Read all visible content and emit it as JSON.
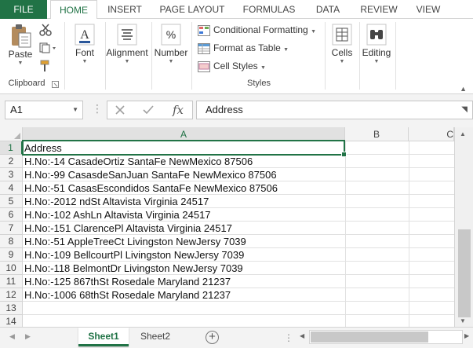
{
  "ribbon_tabs": [
    {
      "label": "FILE"
    },
    {
      "label": "HOME"
    },
    {
      "label": "INSERT"
    },
    {
      "label": "PAGE LAYOUT"
    },
    {
      "label": "FORMULAS"
    },
    {
      "label": "DATA"
    },
    {
      "label": "REVIEW"
    },
    {
      "label": "VIEW"
    }
  ],
  "clipboard": {
    "paste": "Paste",
    "group": "Clipboard"
  },
  "font": {
    "label": "Font"
  },
  "alignment": {
    "label": "Alignment"
  },
  "number": {
    "label": "Number"
  },
  "styles": {
    "conditional": "Conditional Formatting",
    "format_table": "Format as Table",
    "cell_styles": "Cell Styles",
    "group": "Styles"
  },
  "cells": {
    "label": "Cells"
  },
  "editing": {
    "label": "Editing"
  },
  "formula_bar": {
    "name_box": "A1",
    "fx": "fx",
    "content": "Address"
  },
  "grid": {
    "columns": [
      "A",
      "B",
      "C"
    ],
    "rows": [
      "1",
      "2",
      "3",
      "4",
      "5",
      "6",
      "7",
      "8",
      "9",
      "10",
      "11",
      "12",
      "13",
      "14"
    ],
    "cells_a": [
      "Address",
      "H.No:-14 CasadeOrtiz SantaFe NewMexico 87506",
      "H.No:-99 CasasdeSanJuan SantaFe NewMexico 87506",
      "H.No:-51 CasasEscondidos SantaFe NewMexico 87506",
      "H.No:-2012 ndSt Altavista Virginia 24517",
      "H.No:-102 AshLn Altavista Virginia 24517",
      "H.No:-151 ClarencePl Altavista Virginia 24517",
      "H.No:-51 AppleTreeCt Livingston NewJersy 7039",
      "H.No:-109 BellcourtPl Livingston NewJersy 7039",
      "H.No:-118 BelmontDr Livingston NewJersy 7039",
      "H.No:-125 867thSt Rosedale Maryland 21237",
      "H.No:-1006 68thSt Rosedale Maryland 21237"
    ]
  },
  "sheets": [
    {
      "label": "Sheet1"
    },
    {
      "label": "Sheet2"
    }
  ],
  "add_sheet": "+",
  "colors": {
    "accent": "#217346"
  }
}
